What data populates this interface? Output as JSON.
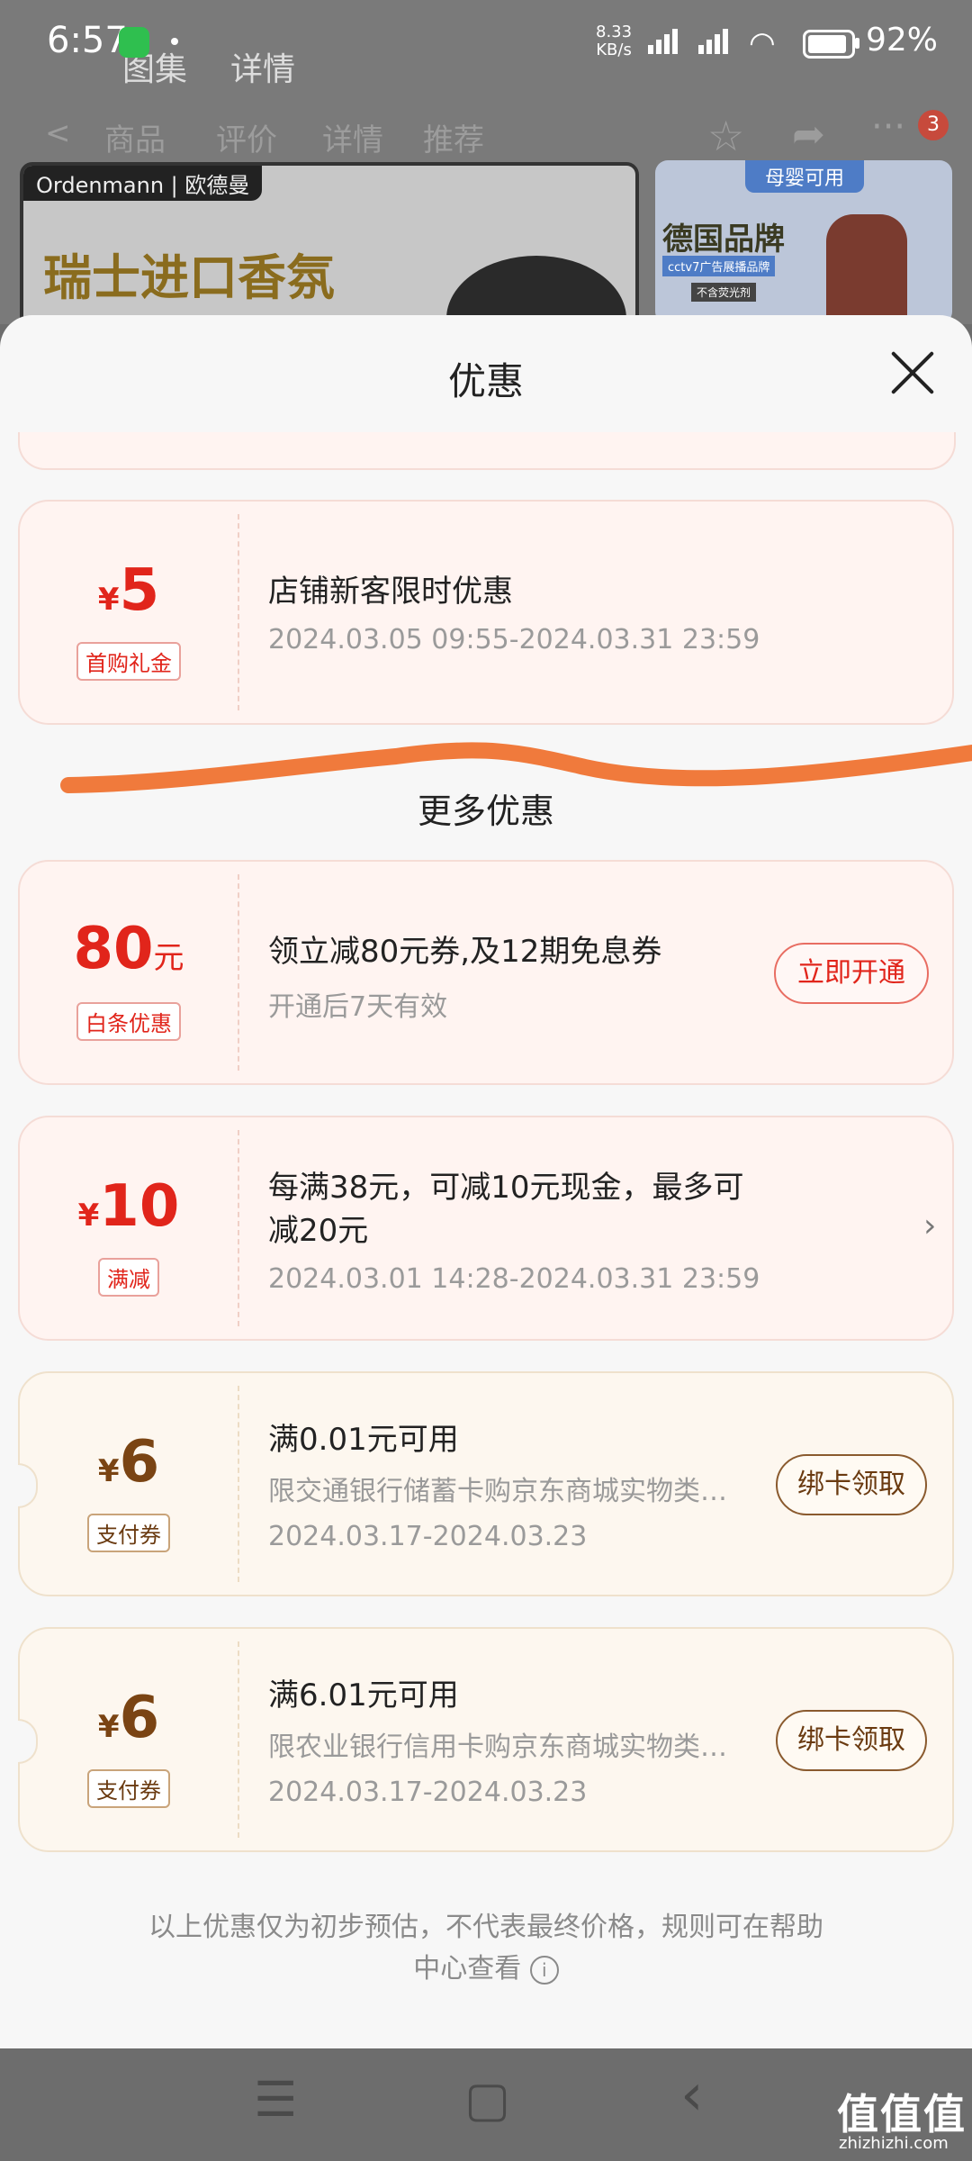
{
  "status_bar": {
    "time": "6:57",
    "speed": "8.33",
    "speed_unit": "KB/s",
    "battery": "92%",
    "battery_level": 0.92
  },
  "page_tabs": [
    "图集",
    "详情"
  ],
  "page_nav": [
    "商品",
    "评价",
    "详情",
    "推荐"
  ],
  "cart_badge": "3",
  "banner": {
    "brand": "Ordenmann | 欧德曼",
    "headline": "瑞士进口香氛"
  },
  "banner2": {
    "tag": "母婴可用",
    "title": "德国品牌",
    "sub": "cctv7广告展播品牌",
    "sub2": "不含荧光剂"
  },
  "sheet": {
    "title": "优惠"
  },
  "coupons": [
    {
      "currency": "¥",
      "amount": "5",
      "tag": "首购礼金",
      "title": "店铺新客限时优惠",
      "period": "2024.03.05 09:55-2024.03.31 23:59"
    }
  ],
  "more_title": "更多优惠",
  "more_coupons": [
    {
      "amount": "80",
      "unit": "元",
      "tag": "白条优惠",
      "title": "领立减80元券,及12期免息券",
      "sub": "开通后7天有效",
      "button": "立即开通"
    },
    {
      "currency": "¥",
      "amount": "10",
      "tag": "满减",
      "title_line1": "每满38元，可减10元现金，最多可",
      "title_line2": "减20元",
      "period": "2024.03.01 14:28-2024.03.31 23:59"
    },
    {
      "currency": "¥",
      "amount": "6",
      "tag": "支付券",
      "title": "满0.01元可用",
      "sub": "限交通银行储蓄卡购京东商城实物类…",
      "period": "2024.03.17-2024.03.23",
      "button": "绑卡领取"
    },
    {
      "currency": "¥",
      "amount": "6",
      "tag": "支付券",
      "title": "满6.01元可用",
      "sub": "限农业银行信用卡购京东商城实物类…",
      "period": "2024.03.17-2024.03.23",
      "button": "绑卡领取"
    }
  ],
  "footer": {
    "line1": "以上优惠仅为初步预估，不代表最终价格，规则可在帮助",
    "line2": "中心查看",
    "info_icon": "i"
  },
  "nav_bar": {
    "menu": "☰",
    "home": "▢",
    "back": "‹"
  },
  "watermark": {
    "text": "值值值",
    "sub": "zhizhizhi.com"
  },
  "colors": {
    "accent_red": "#e1251b",
    "pay_brown": "#7a4413",
    "highlight_stroke": "#f07a3c"
  }
}
